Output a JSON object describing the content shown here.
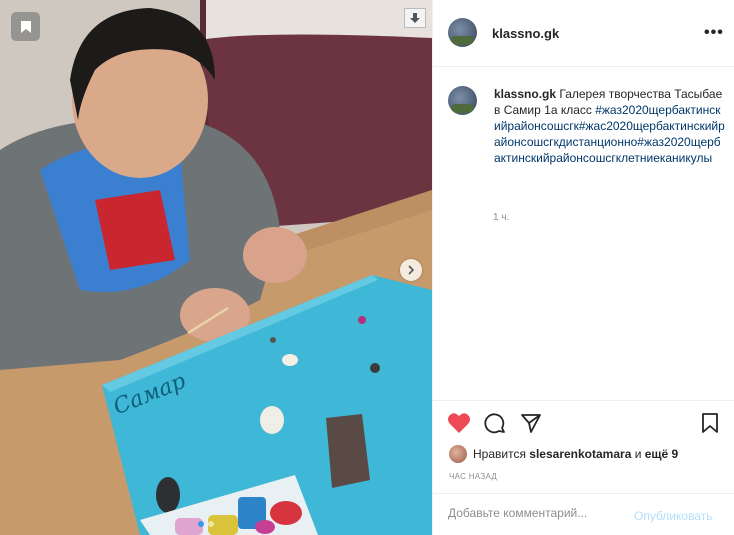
{
  "post": {
    "username": "klassno.gk",
    "caption_user": "klassno.gk",
    "caption_text": " Галерея творчества Тасыбаев Самир 1а класс ",
    "caption_tags": "#жаз2020щербактинскийрайонсошсгк#жас2020щербактинскийрайонсошсгкдистанционно#жаз2020щербактинскийрайонсошсгклетниеканикулы",
    "time_ago": "1 ч."
  },
  "photo": {
    "scene_description_icon": "child-modeling-plasticine-photo",
    "mat_text": "Самар"
  },
  "actions": {
    "liked_by_prefix": "Нравится ",
    "liked_by_user": "slesarenkotamara",
    "liked_by_suffix_and": " и ",
    "liked_by_more": "ещё 9",
    "posted_ago": "ЧАС НАЗАД",
    "heart_color": "#ed4956"
  },
  "comment": {
    "placeholder": "Добавьте комментарий...",
    "publish_label": "Опубликовать"
  },
  "colors": {
    "link": "#00376b",
    "muted": "#8e8e8e",
    "publish_disabled": "#b2dffc"
  }
}
